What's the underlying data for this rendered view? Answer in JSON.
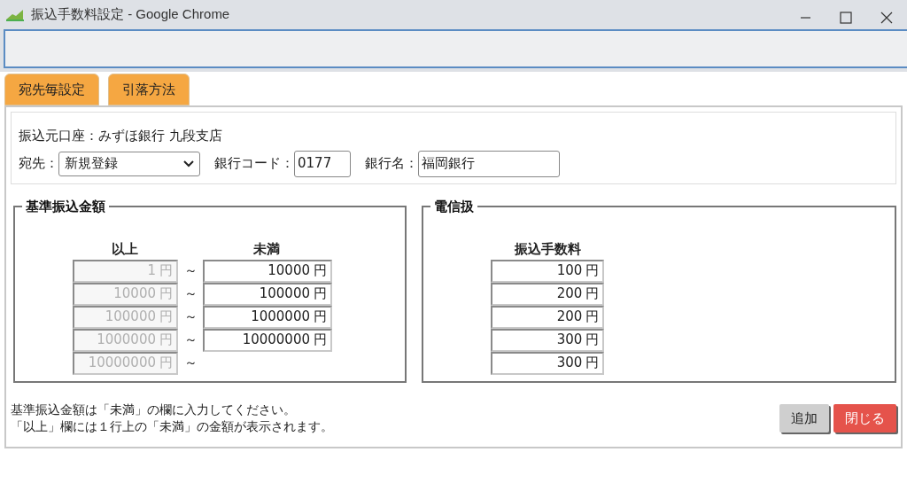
{
  "window": {
    "title": "振込手数料設定 - Google Chrome"
  },
  "tabs": [
    {
      "label": "宛先毎設定"
    },
    {
      "label": "引落方法"
    }
  ],
  "account": {
    "label": "振込元口座：",
    "value": "みずほ銀行 九段支店"
  },
  "payee": {
    "label": "宛先：",
    "value": "新規登録"
  },
  "bank_code": {
    "label": "銀行コード：",
    "value": "0177"
  },
  "bank_name": {
    "label": "銀行名：",
    "value": "福岡銀行"
  },
  "base_amount": {
    "title": "基準振込金額",
    "col_from": "以上",
    "col_to": "未満",
    "rows": [
      {
        "from": {
          "value": "1",
          "unit": "円"
        },
        "separator": "～",
        "to": {
          "value": "10000",
          "unit": "円"
        }
      },
      {
        "from": {
          "value": "10000",
          "unit": "円"
        },
        "separator": "～",
        "to": {
          "value": "100000",
          "unit": "円"
        }
      },
      {
        "from": {
          "value": "100000",
          "unit": "円"
        },
        "separator": "～",
        "to": {
          "value": "1000000",
          "unit": "円"
        }
      },
      {
        "from": {
          "value": "1000000",
          "unit": "円"
        },
        "separator": "～",
        "to": {
          "value": "10000000",
          "unit": "円"
        }
      },
      {
        "from": {
          "value": "10000000",
          "unit": "円"
        },
        "separator": "～"
      }
    ]
  },
  "telegraphic": {
    "title": "電信扱",
    "column": "振込手数料",
    "fees": [
      {
        "value": "100",
        "unit": "円"
      },
      {
        "value": "200",
        "unit": "円"
      },
      {
        "value": "200",
        "unit": "円"
      },
      {
        "value": "300",
        "unit": "円"
      },
      {
        "value": "300",
        "unit": "円"
      }
    ]
  },
  "notes": [
    "基準振込金額は「未満」の欄に入力してください。",
    "「以上」欄には１行上の「未満」の金額が表示されます。"
  ],
  "buttons": [
    {
      "label": "追加",
      "kind": "secondary"
    },
    {
      "label": "閉じる",
      "kind": "danger"
    }
  ]
}
